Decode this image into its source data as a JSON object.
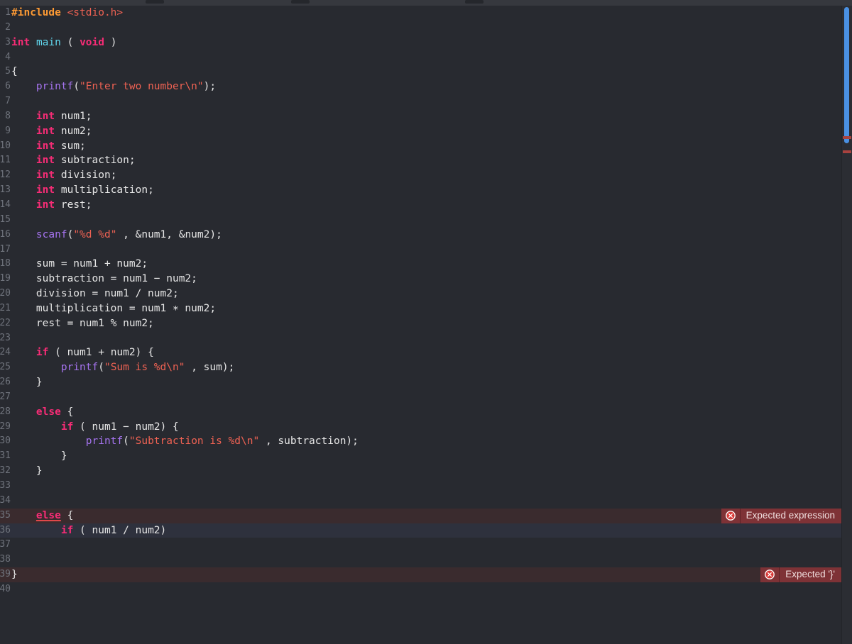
{
  "window": {
    "background_color": "#282a30",
    "gutter_color": "#6f737c",
    "error_row_color": "#3a2b2e",
    "cursor_row_color": "#2e313d",
    "accent_color": "#4a90e2",
    "error_color": "#7e3236"
  },
  "editor": {
    "language": "c",
    "first_visible_line": 1,
    "last_visible_line": 40,
    "cursor_line": 36,
    "lines": [
      {
        "n": "1",
        "indent": 0,
        "state": "normal",
        "tokens": [
          {
            "t": "pre",
            "v": "#include"
          },
          {
            "t": "pun",
            "v": " "
          },
          {
            "t": "str",
            "v": "<stdio.h>"
          }
        ]
      },
      {
        "n": "2",
        "indent": 0,
        "state": "normal",
        "tokens": []
      },
      {
        "n": "3",
        "indent": 0,
        "state": "normal",
        "tokens": [
          {
            "t": "kw",
            "v": "int"
          },
          {
            "t": "pun",
            "v": " "
          },
          {
            "t": "fn",
            "v": "main"
          },
          {
            "t": "pun",
            "v": " ( "
          },
          {
            "t": "kw",
            "v": "void"
          },
          {
            "t": "pun",
            "v": " )"
          }
        ]
      },
      {
        "n": "4",
        "indent": 0,
        "state": "normal",
        "tokens": []
      },
      {
        "n": "5",
        "indent": 0,
        "state": "normal",
        "tokens": [
          {
            "t": "pun",
            "v": "{"
          }
        ]
      },
      {
        "n": "6",
        "indent": 0,
        "state": "normal",
        "tokens": [
          {
            "t": "pun",
            "v": "    "
          },
          {
            "t": "call",
            "v": "printf"
          },
          {
            "t": "pun",
            "v": "("
          },
          {
            "t": "str",
            "v": "\"Enter two number\\n\""
          },
          {
            "t": "pun",
            "v": ");"
          }
        ]
      },
      {
        "n": "7",
        "indent": 0,
        "state": "normal",
        "tokens": []
      },
      {
        "n": "8",
        "indent": 0,
        "state": "normal",
        "tokens": [
          {
            "t": "pun",
            "v": "    "
          },
          {
            "t": "kw",
            "v": "int"
          },
          {
            "t": "id",
            "v": " num1;"
          }
        ]
      },
      {
        "n": "9",
        "indent": 0,
        "state": "normal",
        "tokens": [
          {
            "t": "pun",
            "v": "    "
          },
          {
            "t": "kw",
            "v": "int"
          },
          {
            "t": "id",
            "v": " num2;"
          }
        ]
      },
      {
        "n": "10",
        "indent": 0,
        "state": "normal",
        "tokens": [
          {
            "t": "pun",
            "v": "    "
          },
          {
            "t": "kw",
            "v": "int"
          },
          {
            "t": "id",
            "v": " sum;"
          }
        ]
      },
      {
        "n": "11",
        "indent": 0,
        "state": "normal",
        "tokens": [
          {
            "t": "pun",
            "v": "    "
          },
          {
            "t": "kw",
            "v": "int"
          },
          {
            "t": "id",
            "v": " subtraction;"
          }
        ]
      },
      {
        "n": "12",
        "indent": 0,
        "state": "normal",
        "tokens": [
          {
            "t": "pun",
            "v": "    "
          },
          {
            "t": "kw",
            "v": "int"
          },
          {
            "t": "id",
            "v": " division;"
          }
        ]
      },
      {
        "n": "13",
        "indent": 0,
        "state": "normal",
        "tokens": [
          {
            "t": "pun",
            "v": "    "
          },
          {
            "t": "kw",
            "v": "int"
          },
          {
            "t": "id",
            "v": " multiplication;"
          }
        ]
      },
      {
        "n": "14",
        "indent": 0,
        "state": "normal",
        "tokens": [
          {
            "t": "pun",
            "v": "    "
          },
          {
            "t": "kw",
            "v": "int"
          },
          {
            "t": "id",
            "v": " rest;"
          }
        ]
      },
      {
        "n": "15",
        "indent": 0,
        "state": "normal",
        "tokens": []
      },
      {
        "n": "16",
        "indent": 0,
        "state": "normal",
        "tokens": [
          {
            "t": "pun",
            "v": "    "
          },
          {
            "t": "call",
            "v": "scanf"
          },
          {
            "t": "pun",
            "v": "("
          },
          {
            "t": "str",
            "v": "\"%d %d\""
          },
          {
            "t": "id",
            "v": " , &num1, &num2);"
          }
        ]
      },
      {
        "n": "17",
        "indent": 0,
        "state": "normal",
        "tokens": []
      },
      {
        "n": "18",
        "indent": 0,
        "state": "normal",
        "tokens": [
          {
            "t": "id",
            "v": "    sum = num1 + num2;"
          }
        ]
      },
      {
        "n": "19",
        "indent": 0,
        "state": "normal",
        "tokens": [
          {
            "t": "id",
            "v": "    subtraction = num1 − num2;"
          }
        ]
      },
      {
        "n": "20",
        "indent": 0,
        "state": "normal",
        "tokens": [
          {
            "t": "id",
            "v": "    division = num1 / num2;"
          }
        ]
      },
      {
        "n": "21",
        "indent": 0,
        "state": "normal",
        "tokens": [
          {
            "t": "id",
            "v": "    multiplication = num1 ∗ num2;"
          }
        ]
      },
      {
        "n": "22",
        "indent": 0,
        "state": "normal",
        "tokens": [
          {
            "t": "id",
            "v": "    rest = num1 % num2;"
          }
        ]
      },
      {
        "n": "23",
        "indent": 0,
        "state": "normal",
        "tokens": []
      },
      {
        "n": "24",
        "indent": 0,
        "state": "normal",
        "tokens": [
          {
            "t": "pun",
            "v": "    "
          },
          {
            "t": "kw",
            "v": "if"
          },
          {
            "t": "id",
            "v": " ( num1 + num2) {"
          }
        ]
      },
      {
        "n": "25",
        "indent": 0,
        "state": "normal",
        "tokens": [
          {
            "t": "pun",
            "v": "        "
          },
          {
            "t": "call",
            "v": "printf"
          },
          {
            "t": "pun",
            "v": "("
          },
          {
            "t": "str",
            "v": "\"Sum is %d\\n\""
          },
          {
            "t": "id",
            "v": " , sum);"
          }
        ]
      },
      {
        "n": "26",
        "indent": 0,
        "state": "normal",
        "tokens": [
          {
            "t": "pun",
            "v": "    }"
          }
        ]
      },
      {
        "n": "27",
        "indent": 0,
        "state": "normal",
        "tokens": []
      },
      {
        "n": "28",
        "indent": 0,
        "state": "normal",
        "tokens": [
          {
            "t": "pun",
            "v": "    "
          },
          {
            "t": "kw",
            "v": "else"
          },
          {
            "t": "pun",
            "v": " {"
          }
        ]
      },
      {
        "n": "29",
        "indent": 0,
        "state": "normal",
        "tokens": [
          {
            "t": "pun",
            "v": "        "
          },
          {
            "t": "kw",
            "v": "if"
          },
          {
            "t": "id",
            "v": " ( num1 − num2) {"
          }
        ]
      },
      {
        "n": "30",
        "indent": 0,
        "state": "normal",
        "tokens": [
          {
            "t": "pun",
            "v": "            "
          },
          {
            "t": "call",
            "v": "printf"
          },
          {
            "t": "pun",
            "v": "("
          },
          {
            "t": "str",
            "v": "\"Subtraction is %d\\n\""
          },
          {
            "t": "id",
            "v": " , subtraction);"
          }
        ]
      },
      {
        "n": "31",
        "indent": 0,
        "state": "normal",
        "tokens": [
          {
            "t": "pun",
            "v": "        }"
          }
        ]
      },
      {
        "n": "32",
        "indent": 0,
        "state": "normal",
        "tokens": [
          {
            "t": "pun",
            "v": "    }"
          }
        ]
      },
      {
        "n": "33",
        "indent": 0,
        "state": "normal",
        "tokens": []
      },
      {
        "n": "34",
        "indent": 0,
        "state": "normal",
        "tokens": []
      },
      {
        "n": "35",
        "indent": 0,
        "state": "error",
        "tokens": [
          {
            "t": "pun",
            "v": "    "
          },
          {
            "t": "kw errtok",
            "v": "else"
          },
          {
            "t": "pun",
            "v": " {"
          }
        ]
      },
      {
        "n": "36",
        "indent": 0,
        "state": "cursor",
        "tokens": [
          {
            "t": "pun",
            "v": "        "
          },
          {
            "t": "kw",
            "v": "if"
          },
          {
            "t": "id",
            "v": " ( num1 / num2)"
          }
        ]
      },
      {
        "n": "37",
        "indent": 0,
        "state": "normal",
        "tokens": []
      },
      {
        "n": "38",
        "indent": 0,
        "state": "normal",
        "tokens": []
      },
      {
        "n": "39",
        "indent": 0,
        "state": "error",
        "tokens": [
          {
            "t": "pun",
            "v": "}"
          }
        ]
      },
      {
        "n": "40",
        "indent": 0,
        "state": "normal",
        "tokens": []
      }
    ]
  },
  "diagnostics": [
    {
      "line": "35",
      "severity": "error",
      "icon": "error-circle-x-icon",
      "message": "Expected expression"
    },
    {
      "line": "39",
      "severity": "error",
      "icon": "error-circle-x-icon",
      "message": "Expected '}'"
    }
  ],
  "scrollbar": {
    "orientation": "vertical",
    "thumb_color": "#4a90e2",
    "marker_count": 2
  }
}
